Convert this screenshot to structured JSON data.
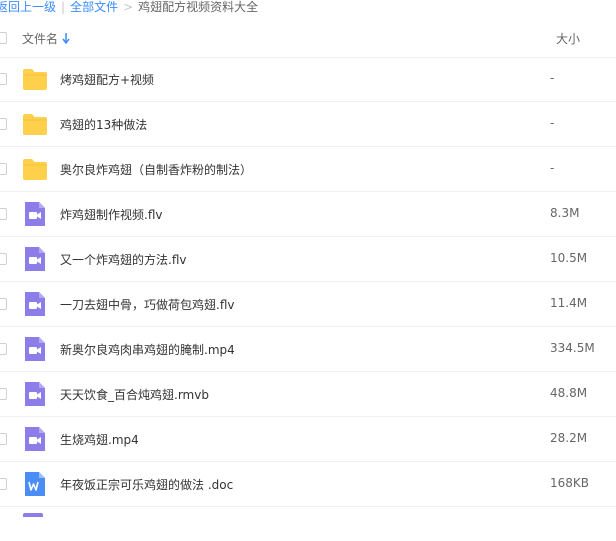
{
  "breadcrumb": {
    "back": "返回上一级",
    "separator": "|",
    "all_files": "全部文件",
    "arrow": ">",
    "current": "鸡翅配方视频资料大全"
  },
  "header": {
    "name_col": "文件名",
    "size_col": "大小"
  },
  "files": [
    {
      "type": "folder",
      "icon": "folder-icon",
      "name": "烤鸡翅配方+视频",
      "size": "-"
    },
    {
      "type": "folder",
      "icon": "folder-icon",
      "name": "鸡翅的13种做法",
      "size": "-"
    },
    {
      "type": "folder",
      "icon": "folder-icon",
      "name": "奥尔良炸鸡翅（自制香炸粉的制法）",
      "size": "-"
    },
    {
      "type": "video",
      "icon": "video-file-icon",
      "name": "炸鸡翅制作视频.flv",
      "size": "8.3M"
    },
    {
      "type": "video",
      "icon": "video-file-icon",
      "name": "又一个炸鸡翅的方法.flv",
      "size": "10.5M"
    },
    {
      "type": "video",
      "icon": "video-file-icon",
      "name": "一刀去翅中骨，巧做荷包鸡翅.flv",
      "size": "11.4M"
    },
    {
      "type": "video",
      "icon": "video-file-icon",
      "name": "新奥尔良鸡肉串鸡翅的腌制.mp4",
      "size": "334.5M"
    },
    {
      "type": "video",
      "icon": "video-file-icon",
      "name": "天天饮食_百合炖鸡翅.rmvb",
      "size": "48.8M"
    },
    {
      "type": "video",
      "icon": "video-file-icon",
      "name": "生烧鸡翅.mp4",
      "size": "28.2M"
    },
    {
      "type": "word",
      "icon": "word-doc-icon",
      "name": "年夜饭正宗可乐鸡翅的做法 .doc",
      "size": "168KB"
    }
  ],
  "colors": {
    "link": "#3b8cff",
    "folder": "#ffd04b",
    "video": "#8d7de8",
    "word": "#4a8ef5"
  }
}
